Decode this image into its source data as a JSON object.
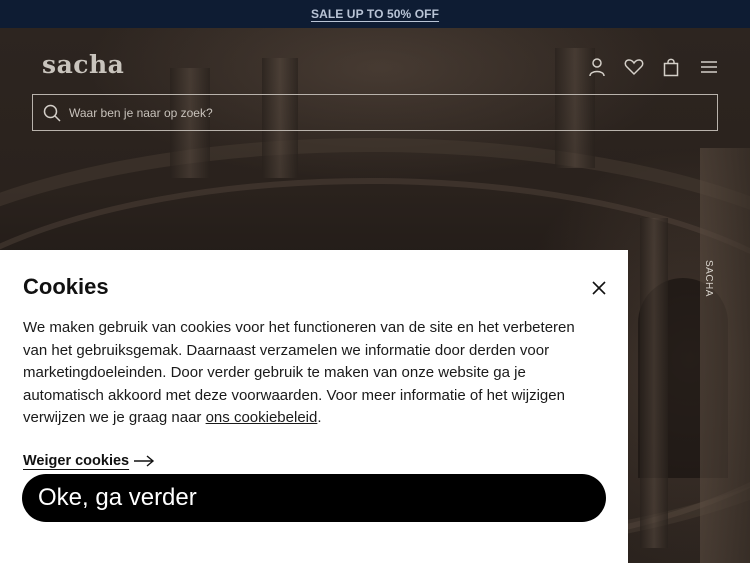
{
  "promo": {
    "text": "SALE UP TO 50% OFF"
  },
  "header": {
    "logo": "sacha",
    "icons": [
      "account-icon",
      "heart-icon",
      "shopping-bag-icon",
      "hamburger-menu-icon"
    ],
    "search": {
      "placeholder": "Waar ben je naar op zoek?",
      "value": ""
    }
  },
  "hero": {
    "side_label": "SACHA"
  },
  "cookies": {
    "title": "Cookies",
    "body": "We maken gebruik van cookies voor het functioneren van de site en het verbeteren van het gebruiksgemak. Daarnaast verzamelen we informatie door derden voor marketingdoeleinden. Door verder gebruik te maken van onze website ga je automatisch akkoord met deze voorwaarden. Voor meer informatie of het wijzigen verwijzen we je graag naar ",
    "policy_link": "ons cookiebeleid",
    "body_end": ".",
    "decline": "Weiger cookies",
    "accept": "Oke, ga verder"
  },
  "colors": {
    "promo_bg": "#0e1c33",
    "promo_text": "#b9c4d6",
    "button_bg": "#000000",
    "panel_bg": "#ffffff"
  }
}
